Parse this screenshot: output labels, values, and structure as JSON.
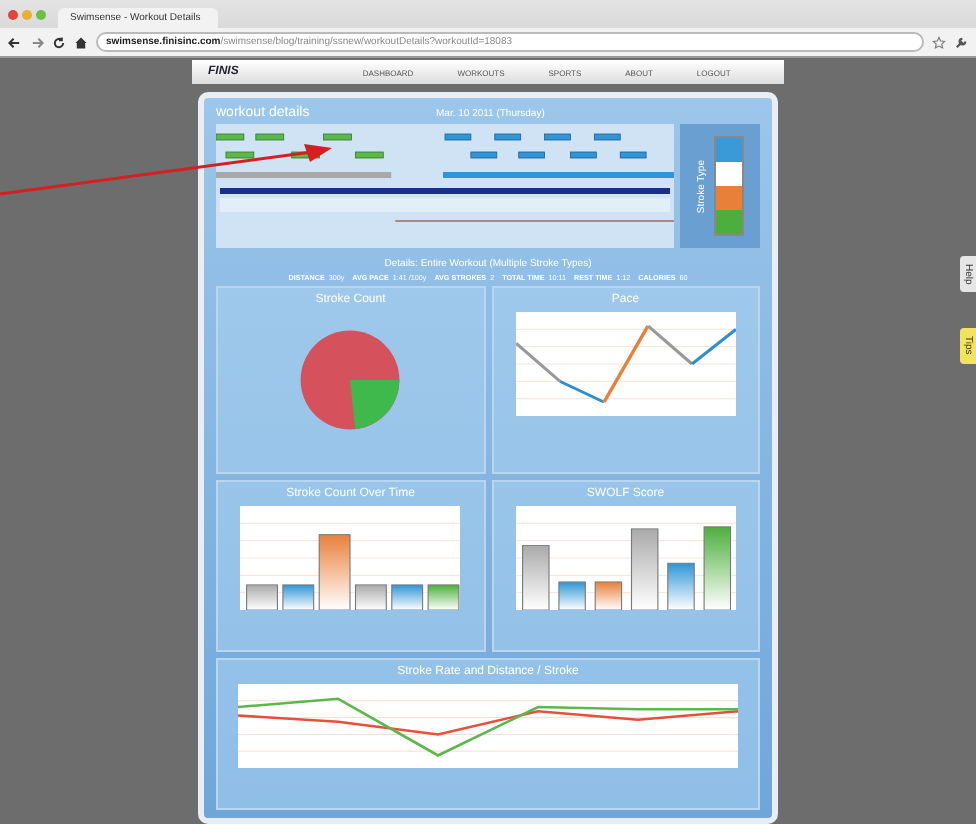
{
  "browser": {
    "tab_title": "Swimsense - Workout Details",
    "url_host": "swimsense.finisinc.com",
    "url_path": "/swimsense/blog/training/ssnew/workoutDetails?workoutId=18083"
  },
  "nav": {
    "logo": "FINIS",
    "items": [
      "DASHBOARD",
      "WORKOUTS",
      "SPORTS",
      "ABOUT",
      "LOGOUT"
    ]
  },
  "panel": {
    "title": "workout details",
    "date": "Mar. 10 2011 (Thursday)",
    "legend_title": "Stroke Type",
    "legend": [
      {
        "color": "#3a9ad8"
      },
      {
        "color": "#ffffff"
      },
      {
        "color": "#e8803a"
      },
      {
        "color": "#4caf3c"
      }
    ],
    "details": "Details: Entire Workout (Multiple Stroke Types)",
    "stats": [
      {
        "label": "DISTANCE",
        "value": "300y"
      },
      {
        "label": "AVG PACE",
        "value": "1:41 /100y"
      },
      {
        "label": "AVG STROKES",
        "value": "2"
      },
      {
        "label": "TOTAL TIME",
        "value": "10:11"
      },
      {
        "label": "REST TIME",
        "value": "1:12"
      },
      {
        "label": "CALORIES",
        "value": "60"
      }
    ]
  },
  "charts": [
    {
      "kind": "pie",
      "title": "Stroke Count"
    },
    {
      "kind": "line",
      "title": "Pace"
    },
    {
      "kind": "bar",
      "title": "Stroke Count Over Time"
    },
    {
      "kind": "bar2",
      "title": "SWOLF Score"
    },
    {
      "kind": "dual",
      "title": "Stroke Rate and Distance / Stroke"
    }
  ],
  "side_tabs": [
    {
      "label": "Help",
      "color": "#e6e6e6"
    },
    {
      "label": "Tips",
      "color": "#f3e35a"
    }
  ]
}
